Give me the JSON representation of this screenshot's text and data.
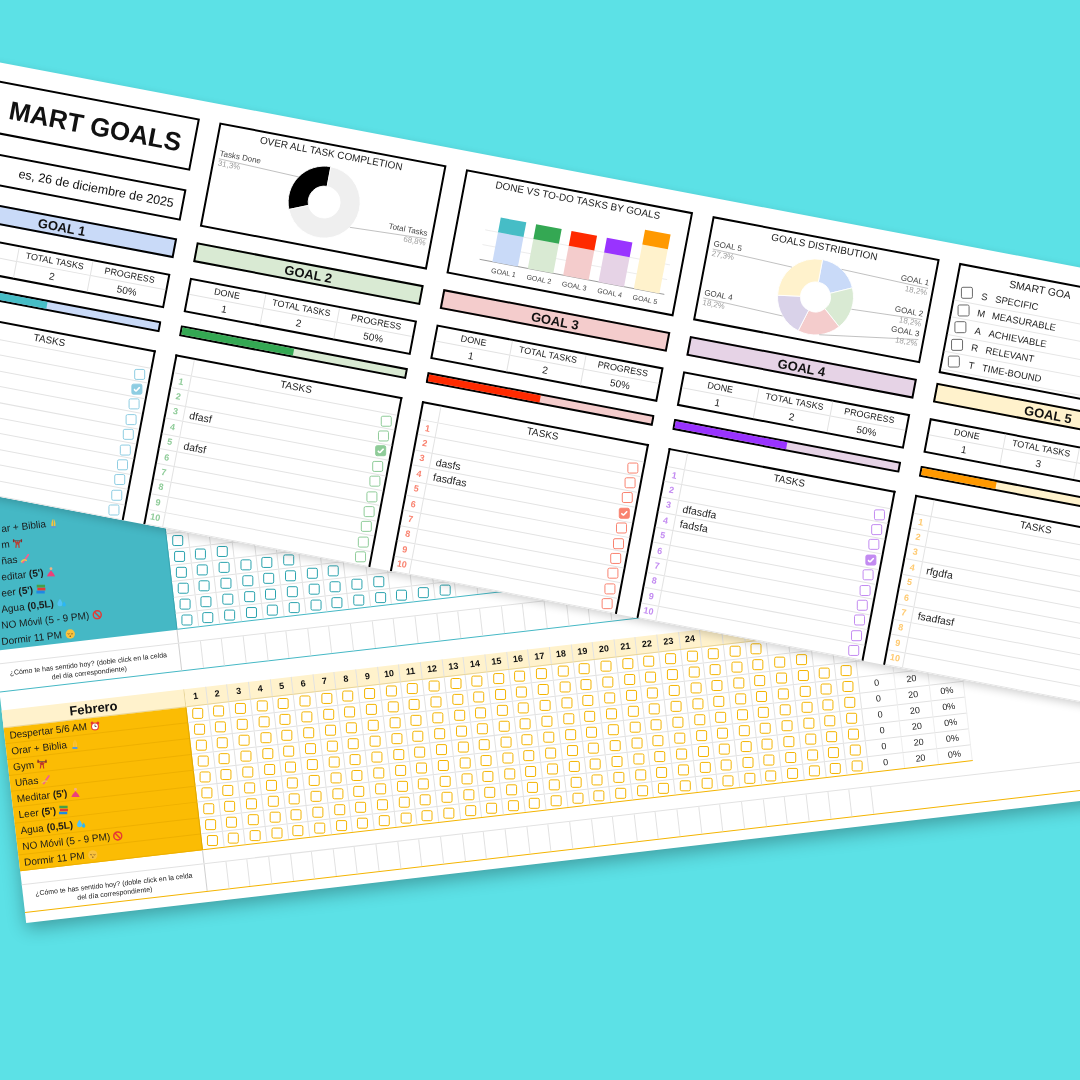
{
  "planner": {
    "title": "MART GOALS",
    "date": "es, 26 de diciembre de 2025",
    "completion_chart": {
      "chart_data": {
        "type": "donut",
        "title": "OVER ALL TASK COMPLETION",
        "categories": [
          "Tasks Done",
          "Total Tasks"
        ],
        "values": [
          31.3,
          68.8
        ],
        "value_labels": [
          "31,3%",
          "68,8%"
        ],
        "colors": [
          "#000000",
          "#efefef"
        ]
      }
    },
    "done_vs_todo_chart": {
      "title": "DONE VS TO-DO TASKS BY GOALS",
      "labels": [
        "GOAL 1",
        "GOAL 2",
        "GOAL 3",
        "GOAL 4",
        "GOAL 5"
      ]
    },
    "distribution_chart": {
      "chart_data": {
        "type": "donut",
        "title": "GOALS DISTRIBUTION",
        "categories": [
          "GOAL 1",
          "GOAL 2",
          "GOAL 3",
          "GOAL 4",
          "GOAL 5"
        ],
        "values": [
          18.2,
          18.2,
          18.2,
          18.2,
          27.3
        ],
        "value_labels": [
          "18,2%",
          "18,2%",
          "18,2%",
          "18,2%",
          "27,3%"
        ],
        "colors": [
          "#c9daf8",
          "#d9ead3",
          "#f4cccc",
          "#d9d2e9",
          "#fff2cc"
        ]
      }
    },
    "smart_legend": {
      "title": "SMART GOA",
      "items": [
        {
          "letter": "S",
          "word": "SPECIFIC",
          "checked": false
        },
        {
          "letter": "M",
          "word": "MEASURABLE",
          "checked": false
        },
        {
          "letter": "A",
          "word": "ACHIEVABLE",
          "checked": false
        },
        {
          "letter": "R",
          "word": "RELEVANT",
          "checked": false
        },
        {
          "letter": "T",
          "word": "TIME-BOUND",
          "checked": false
        }
      ]
    },
    "goals": [
      {
        "header": {
          "title": "GOAL 1",
          "color": "#c9daf8"
        },
        "color": "#46bdc6",
        "stats": {
          "total_label": "TOTAL TASKS",
          "total": "2",
          "progress_label": "PROGRESS",
          "progress": "50%"
        },
        "level": 0.5,
        "tasks_title": "TASKS",
        "tasks": [
          {
            "checked": false
          },
          {
            "checked": true
          },
          {
            "checked": false
          },
          {
            "checked": false
          },
          {
            "checked": false
          },
          {
            "checked": false
          },
          {
            "checked": false
          },
          {
            "checked": false
          },
          {
            "checked": false
          },
          {
            "checked": false
          }
        ]
      },
      {
        "header": {
          "title": "GOAL 2",
          "color": "#d9ead3"
        },
        "color": "#34a853",
        "stats": {
          "done_label": "DONE",
          "done": "1",
          "total_label": "TOTAL TASKS",
          "total": "2",
          "progress_label": "PROGRESS",
          "progress": "50%"
        },
        "level": 0.5,
        "tasks_title": "TASKS",
        "tasks": [
          {
            "number": "1",
            "checked": false
          },
          {
            "number": "2",
            "checked": false
          },
          {
            "number": "3",
            "text": "dfasf",
            "checked": true
          },
          {
            "number": "4",
            "checked": false
          },
          {
            "number": "5",
            "text": "dafsf",
            "checked": false
          },
          {
            "number": "6",
            "checked": false
          },
          {
            "number": "7",
            "checked": false
          },
          {
            "number": "8",
            "checked": false
          },
          {
            "number": "9",
            "checked": false
          },
          {
            "number": "10",
            "checked": false
          }
        ]
      },
      {
        "header": {
          "title": "GOAL 3",
          "color": "#f4cccc"
        },
        "color": "#ff2a00",
        "stats": {
          "done_label": "DONE",
          "done": "1",
          "total_label": "TOTAL TASKS",
          "total": "2",
          "progress_label": "PROGRESS",
          "progress": "50%"
        },
        "level": 0.5,
        "tasks_title": "TASKS",
        "tasks": [
          {
            "number": "1",
            "checked": false
          },
          {
            "number": "2",
            "checked": false
          },
          {
            "number": "3",
            "text": "dasfs",
            "checked": false
          },
          {
            "number": "4",
            "text": "fasdfas",
            "checked": true
          },
          {
            "number": "5",
            "checked": false
          },
          {
            "number": "6",
            "checked": false
          },
          {
            "number": "7",
            "checked": false
          },
          {
            "number": "8",
            "checked": false
          },
          {
            "number": "9",
            "checked": false
          },
          {
            "number": "10",
            "checked": false
          }
        ]
      },
      {
        "header": {
          "title": "GOAL 4",
          "color": "#e6d3e6"
        },
        "color": "#9933ff",
        "stats": {
          "done_label": "DONE",
          "done": "1",
          "total_label": "TOTAL TASKS",
          "total": "2",
          "progress_label": "PROGRESS",
          "progress": "50%"
        },
        "level": 0.5,
        "tasks_title": "TASKS",
        "tasks": [
          {
            "number": "1",
            "checked": false
          },
          {
            "number": "2",
            "checked": false
          },
          {
            "number": "3",
            "text": "dfasdfa",
            "checked": false
          },
          {
            "number": "4",
            "text": "fadsfa",
            "checked": true
          },
          {
            "number": "5",
            "checked": false
          },
          {
            "number": "6",
            "checked": false
          },
          {
            "number": "7",
            "checked": false
          },
          {
            "number": "8",
            "checked": false
          },
          {
            "number": "9",
            "checked": false
          },
          {
            "number": "10",
            "checked": false
          }
        ]
      },
      {
        "header": {
          "title": "GOAL 5",
          "color": "#fff2cc"
        },
        "color": "#ff9900",
        "stats": {
          "done_label": "DONE",
          "done": "1",
          "total_label": "TOTAL TASKS",
          "total": "3"
        },
        "level": 0.333,
        "tasks_title": "TASKS",
        "tasks": [
          {
            "number": "1"
          },
          {
            "number": "2"
          },
          {
            "number": "3"
          },
          {
            "number": "4",
            "text": "rfgdfa"
          },
          {
            "number": "5"
          },
          {
            "number": "6"
          },
          {
            "number": "7",
            "text": "fsadfasf"
          },
          {
            "number": "8"
          },
          {
            "number": "9"
          },
          {
            "number": "10"
          }
        ]
      }
    ]
  },
  "tracker": {
    "january": {
      "rows": [
        {
          "kind": "pray",
          "label": "ar + Biblia"
        },
        {
          "kind": "gym",
          "label": "m"
        },
        {
          "kind": "nails",
          "label": "ñas",
          "checks": [
            false
          ]
        },
        {
          "kind": "meditate",
          "label": "editar **(5')**",
          "checks": [
            false,
            false,
            false
          ]
        },
        {
          "kind": "read",
          "label": "eer **(5')**",
          "checks": [
            false,
            false,
            false,
            false,
            false,
            false
          ]
        },
        {
          "kind": "water",
          "label": "Agua **(0,5L)**",
          "checks": [
            false,
            false,
            false,
            false,
            false,
            false,
            false,
            false
          ]
        },
        {
          "kind": "phone",
          "label": "NO Móvil (5 - 9 PM)",
          "checks": [
            false,
            false,
            false,
            false,
            false,
            false,
            false,
            false,
            false,
            false
          ]
        },
        {
          "kind": "sleep",
          "label": "Dormir 11 PM",
          "checks": [
            false,
            false,
            false,
            false,
            false,
            false,
            false,
            false,
            false,
            false,
            false,
            false,
            false
          ]
        }
      ],
      "mood_prompt": "¿Cómo te has sentido hoy? (doble click en la celda del día correspondiente)"
    },
    "february": {
      "month": "Febrero",
      "days": [
        "1",
        "2",
        "3",
        "4",
        "5",
        "6",
        "7",
        "8",
        "9",
        "10",
        "11",
        "12",
        "13",
        "14",
        "15",
        "16",
        "17",
        "18",
        "19",
        "20",
        "21",
        "22",
        "23",
        "24"
      ],
      "rows": [
        {
          "kind": "wake",
          "label": "Despertar 5/6 AM",
          "checks": [
            false,
            false,
            false,
            false,
            false,
            false,
            false,
            false,
            false,
            false,
            false,
            false,
            false,
            false,
            false,
            false,
            false,
            false,
            false,
            false,
            false,
            false,
            false,
            false,
            false,
            false,
            false
          ]
        },
        {
          "kind": "pray",
          "label": "Orar + Biblia",
          "checks": [
            false,
            false,
            false,
            false,
            false,
            false,
            false,
            false,
            false,
            false,
            false,
            false,
            false,
            false,
            false,
            false,
            false,
            false,
            false,
            false,
            false,
            false,
            false,
            false,
            false,
            false,
            false,
            false,
            false
          ]
        },
        {
          "kind": "gym",
          "label": "Gym",
          "checks": [
            false,
            false,
            false,
            false,
            false,
            false,
            false,
            false,
            false,
            false,
            false,
            false,
            false,
            false,
            false,
            false,
            false,
            false,
            false,
            false,
            false,
            false,
            false,
            false,
            false,
            false,
            false,
            false,
            false,
            false,
            false
          ]
        },
        {
          "kind": "nails",
          "label": "Uñas",
          "checks": [
            false,
            false,
            false,
            false,
            false,
            false,
            false,
            false,
            false,
            false,
            false,
            false,
            false,
            false,
            false,
            false,
            false,
            false,
            false,
            false,
            false,
            false,
            false,
            false,
            false,
            false,
            false,
            false,
            false,
            false,
            false
          ],
          "stats": [
            "0",
            "20"
          ]
        },
        {
          "kind": "meditate",
          "label": "Meditar **(5')**",
          "checks": [
            false,
            false,
            false,
            false,
            false,
            false,
            false,
            false,
            false,
            false,
            false,
            false,
            false,
            false,
            false,
            false,
            false,
            false,
            false,
            false,
            false,
            false,
            false,
            false,
            false,
            false,
            false,
            false,
            false,
            false,
            false
          ],
          "stats": [
            "0",
            "20",
            "0%"
          ]
        },
        {
          "kind": "read",
          "label": "Leer **(5')**",
          "checks": [
            false,
            false,
            false,
            false,
            false,
            false,
            false,
            false,
            false,
            false,
            false,
            false,
            false,
            false,
            false,
            false,
            false,
            false,
            false,
            false,
            false,
            false,
            false,
            false,
            false,
            false,
            false,
            false,
            false,
            false,
            false
          ],
          "stats": [
            "0",
            "20",
            "0%"
          ]
        },
        {
          "kind": "water",
          "label": "Agua **(0,5L)**",
          "checks": [
            false,
            false,
            false,
            false,
            false,
            false,
            false,
            false,
            false,
            false,
            false,
            false,
            false,
            false,
            false,
            false,
            false,
            false,
            false,
            false,
            false,
            false,
            false,
            false,
            false,
            false,
            false,
            false,
            false,
            false,
            false
          ],
          "stats": [
            "0",
            "20",
            "0%"
          ]
        },
        {
          "kind": "phone",
          "label": "NO Móvil (5 - 9 PM)",
          "checks": [
            false,
            false,
            false,
            false,
            false,
            false,
            false,
            false,
            false,
            false,
            false,
            false,
            false,
            false,
            false,
            false,
            false,
            false,
            false,
            false,
            false,
            false,
            false,
            false,
            false,
            false,
            false,
            false,
            false,
            false,
            false
          ],
          "stats": [
            "0",
            "20",
            "0%"
          ]
        },
        {
          "kind": "sleep",
          "label": "Dormir 11 PM",
          "checks": [
            false,
            false,
            false,
            false,
            false,
            false,
            false,
            false,
            false,
            false,
            false,
            false,
            false,
            false,
            false,
            false,
            false,
            false,
            false,
            false,
            false,
            false,
            false,
            false,
            false,
            false,
            false,
            false,
            false,
            false,
            false
          ],
          "stats": [
            "0",
            "20",
            "0%"
          ]
        }
      ],
      "mood_prompt": "¿Cómo te has sentido hoy? (doble click en la celda del día correspondiente)"
    }
  }
}
